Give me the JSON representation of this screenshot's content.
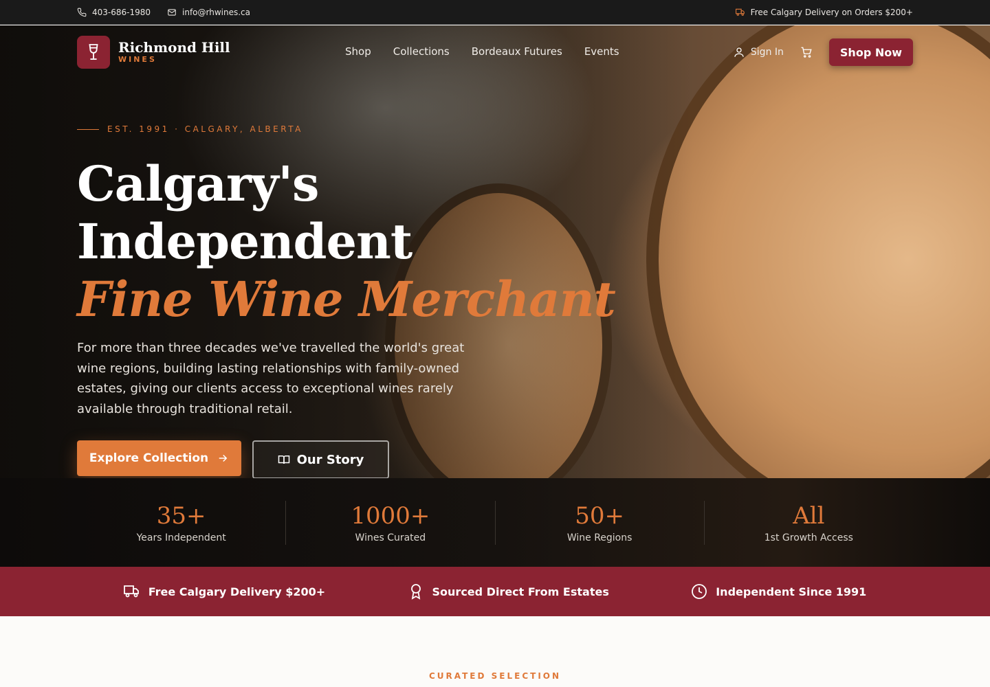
{
  "topbar": {
    "phone": "403-686-1980",
    "email": "info@rhwines.ca",
    "delivery_notice": "Free Calgary Delivery on Orders $200+"
  },
  "brand": {
    "name": "Richmond Hill",
    "sub": "WINES",
    "color_primary": "#8b2332",
    "color_accent": "#e07a3a"
  },
  "nav": {
    "links": [
      "Shop",
      "Collections",
      "Bordeaux Futures",
      "Events"
    ],
    "signin": "Sign In",
    "shop_now": "Shop Now"
  },
  "hero": {
    "eyebrow": "EST. 1991 · CALGARY, ALBERTA",
    "headline_line1": "Calgary's",
    "headline_line2": "Independent",
    "headline_accent": "Fine Wine Merchant",
    "lede": "For more than three decades we've travelled the world's great wine regions, building lasting relationships with family-owned estates, giving our clients access to exceptional wines rarely available through traditional retail.",
    "cta_primary": "Explore Collection",
    "cta_secondary": "Our Story"
  },
  "stats": [
    {
      "value": "35+",
      "label": "Years Independent"
    },
    {
      "value": "1000+",
      "label": "Wines Curated"
    },
    {
      "value": "50+",
      "label": "Wine Regions"
    },
    {
      "value": "All",
      "label": "1st Growth Access"
    }
  ],
  "features": [
    {
      "icon": "truck-icon",
      "label": "Free Calgary Delivery $200+"
    },
    {
      "icon": "award-icon",
      "label": "Sourced Direct From Estates"
    },
    {
      "icon": "clock-icon",
      "label": "Independent Since 1991"
    }
  ],
  "section": {
    "eyebrow": "CURATED SELECTION"
  }
}
